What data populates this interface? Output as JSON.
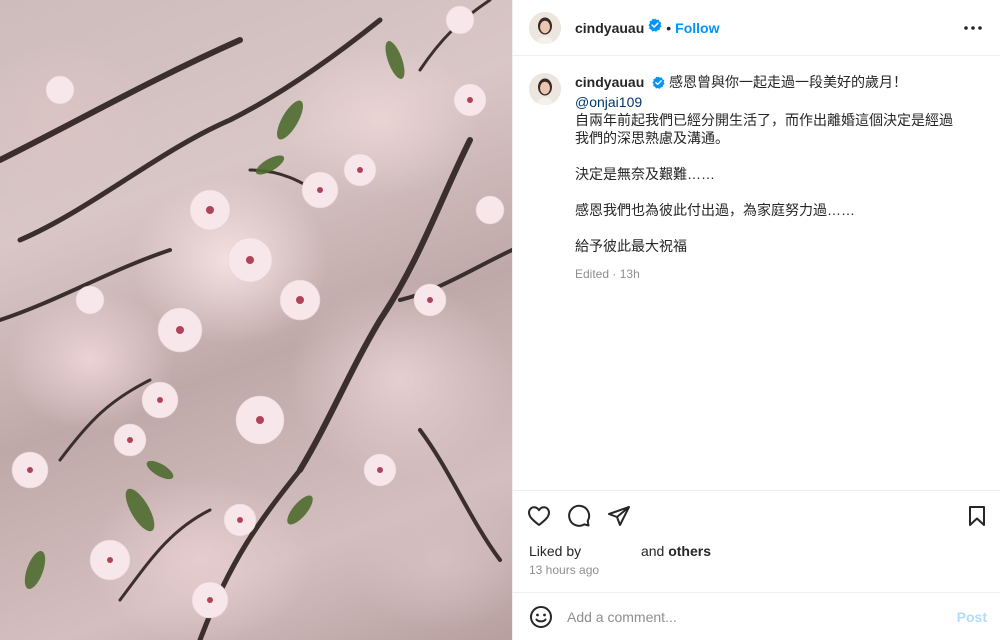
{
  "post": {
    "username": "cindyauau",
    "follow_label": "Follow",
    "separator": "•",
    "caption": {
      "username": "cindyauau",
      "first_line": "感恩曾與你一起走過一段美好的歲月！",
      "mention": "@onjai109",
      "line2": "自兩年前起我們已經分開生活了，而作出離婚這個決定是經過我們的深思熟慮及溝通。",
      "line3": "決定是無奈及艱難……",
      "line4": "感恩我們也為彼此付出過，為家庭努力過……",
      "line5": "給予彼此最大祝福"
    },
    "edited_label": "Edited",
    "edited_sep": "·",
    "edited_time": "13h",
    "likes": {
      "prefix": "Liked by",
      "and": "and",
      "others": "others"
    },
    "time_ago": "13 hours ago",
    "comment": {
      "placeholder": "Add a comment...",
      "post_label": "Post"
    }
  },
  "icons": {
    "verified": "verified-badge-icon",
    "more": "more-options-icon",
    "like": "heart-icon",
    "comment": "comment-icon",
    "share": "share-icon",
    "save": "bookmark-icon",
    "emoji": "emoji-icon"
  },
  "colors": {
    "follow": "#0095f6",
    "mention": "#00376b",
    "secondary_text": "#8e8e8e",
    "post_disabled": "#b3dbff",
    "verified": "#0095f6"
  }
}
